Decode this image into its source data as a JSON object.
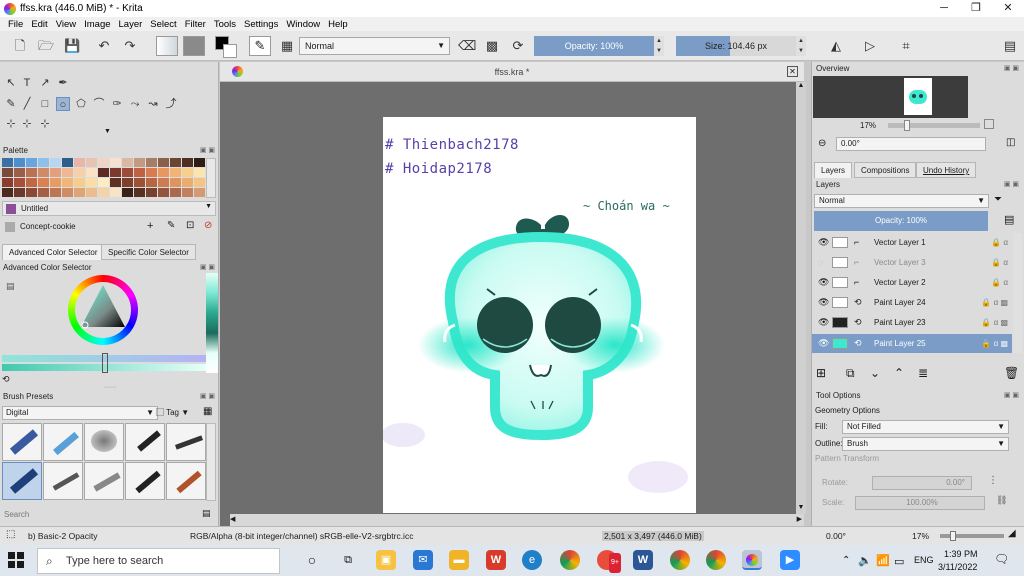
{
  "window": {
    "title": "ffss.kra (446.0 MiB)  * - Krita",
    "controls": [
      "─",
      "❐",
      "✕"
    ]
  },
  "menu": [
    "File",
    "Edit",
    "View",
    "Image",
    "Layer",
    "Select",
    "Filter",
    "Tools",
    "Settings",
    "Window",
    "Help"
  ],
  "toolbar": {
    "blend_mode": "Normal",
    "opacity_label": "Opacity: 100%",
    "size_label": "Size: 104.46 px"
  },
  "document": {
    "tab_title": "ffss.kra *",
    "canvas_text_1": "# Thienbach2178",
    "canvas_text_2": "# Hoidap2178",
    "canvas_text_3": "~ Choán wa ~"
  },
  "left": {
    "palette_header": "Palette",
    "palette_name": "Untitled",
    "palette_resource": "Concept-cookie",
    "tab_advanced": "Advanced Color Selector",
    "tab_specific": "Specific Color Selector",
    "advanced_header": "Advanced Color Selector",
    "brush_presets_header": "Brush Presets",
    "brush_tag_filter": "Digital",
    "tag_label": "Tag",
    "search_placeholder": "Search",
    "palette_colors": [
      "#3c6fa3",
      "#4b8fcf",
      "#6aa6de",
      "#8fc0ea",
      "#b8d6f0",
      "#2e5d8a",
      "#e8b5a6",
      "#e6c3b3",
      "#f0d5c6",
      "#f4e1d2",
      "#d9b8a6",
      "#c49a82",
      "#a87d66",
      "#8c5f4a",
      "#6b4533",
      "#4e3022",
      "#2f1c13",
      "#7a4a3a",
      "#9b5e48",
      "#b87256",
      "#cf8a6a",
      "#e2a07e",
      "#efb894",
      "#f6cfad",
      "#fbe1c6",
      "#5c2c24",
      "#7c3a2d",
      "#9e4c37",
      "#bf6241",
      "#d97b4e",
      "#e8975f",
      "#f2b374",
      "#f8cf8e",
      "#fbe4ad",
      "#8a3d2e",
      "#a84f39",
      "#c26744",
      "#d88152",
      "#e89c63",
      "#f1b676",
      "#f6cd8d",
      "#f9dfa7",
      "#fcecc4",
      "#5e3120",
      "#7d402a",
      "#9c5236",
      "#b76642",
      "#cc7c4f",
      "#dd945e",
      "#eaad70",
      "#f2c587",
      "#4b2a1f",
      "#6a3a2a",
      "#894b36",
      "#a55f43",
      "#bd7552",
      "#d08c63",
      "#e0a577",
      "#ebbd8e",
      "#f3d3a8",
      "#f8e4c4",
      "#3a2219",
      "#573124",
      "#754230",
      "#92553e",
      "#ab6a4e",
      "#c18160",
      "#d39a75"
    ]
  },
  "status": {
    "brush": "b) Basic-2 Opacity",
    "color_space": "RGB/Alpha (8-bit integer/channel)  sRGB-elle-V2-srgbtrc.icc",
    "dimensions": "2,501 x 3,497 (446.0 MiB)",
    "rotation": "0.00°",
    "zoom": "17%"
  },
  "right": {
    "overview_header": "Overview",
    "overview_zoom": "17%",
    "overview_rotation": "0.00°",
    "tabs": [
      "Layers",
      "Compositions",
      "Undo History"
    ],
    "layers_header": "Layers",
    "blend_mode": "Normal",
    "opacity_label": "Opacity:  100%",
    "layers": [
      {
        "name": "Vector Layer 1",
        "visible": true
      },
      {
        "name": "Vector Layer 3",
        "visible": false
      },
      {
        "name": "Vector Layer 2",
        "visible": true
      },
      {
        "name": "Paint Layer 24",
        "visible": true
      },
      {
        "name": "Paint Layer 23",
        "visible": true
      },
      {
        "name": "Paint Layer 25",
        "visible": true,
        "selected": true
      }
    ],
    "tool_options_header": "Tool Options",
    "geometry_header": "Geometry Options",
    "fill_label": "Fill:",
    "fill_value": "Not Filled",
    "outline_label": "Outline:",
    "outline_value": "Brush",
    "pattern_transform": "Pattern Transform",
    "rotate_label": "Rotate:",
    "rotate_value": "0.00°",
    "scale_label": "Scale:",
    "scale_value": "100.00%"
  },
  "taskbar": {
    "search_placeholder": "Type here to search",
    "time": "1:39 PM",
    "date": "3/11/2022",
    "lang": "ENG",
    "badge": "9+"
  },
  "colors": {
    "selection_blue": "#7a9cc6",
    "mint": "#3ee8d0",
    "dark_teal": "#1e4a42",
    "canvas_bg": "#6e6e6e"
  }
}
